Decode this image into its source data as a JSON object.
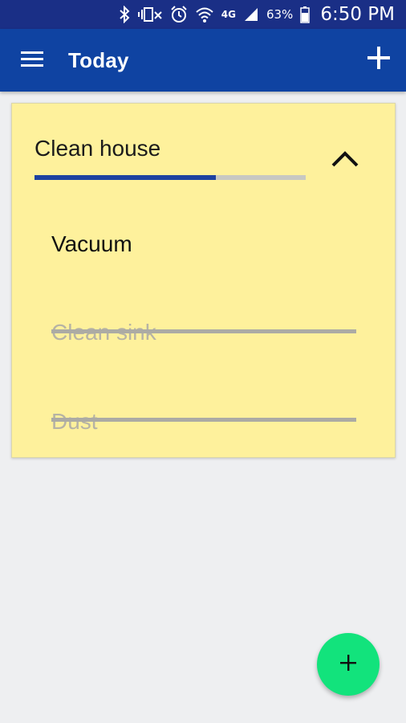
{
  "status_bar": {
    "battery_text": "63%",
    "time": "6:50 PM",
    "icons": [
      "bluetooth-icon",
      "vibrate-mute-icon",
      "alarm-icon",
      "wifi-icon",
      "lte-icon",
      "signal-icon",
      "battery-icon"
    ],
    "network_label": "4G"
  },
  "app_bar": {
    "title": "Today",
    "menu_icon": "menu-icon",
    "add_icon": "plus-icon"
  },
  "task": {
    "title": "Clean house",
    "progress": 0.67,
    "expanded": true,
    "collapse_icon": "chevron-up-icon",
    "subtasks": [
      {
        "label": "Vacuum",
        "done": false
      },
      {
        "label": "Clean sink",
        "done": true
      },
      {
        "label": "Dust",
        "done": true
      }
    ]
  },
  "fab": {
    "icon": "plus-icon"
  },
  "colors": {
    "status_bar": "#1a2f86",
    "app_bar": "#0f43a2",
    "card": "#fef19c",
    "progress": "#1d42a0",
    "fab": "#12e37c",
    "background": "#eeeff1"
  }
}
